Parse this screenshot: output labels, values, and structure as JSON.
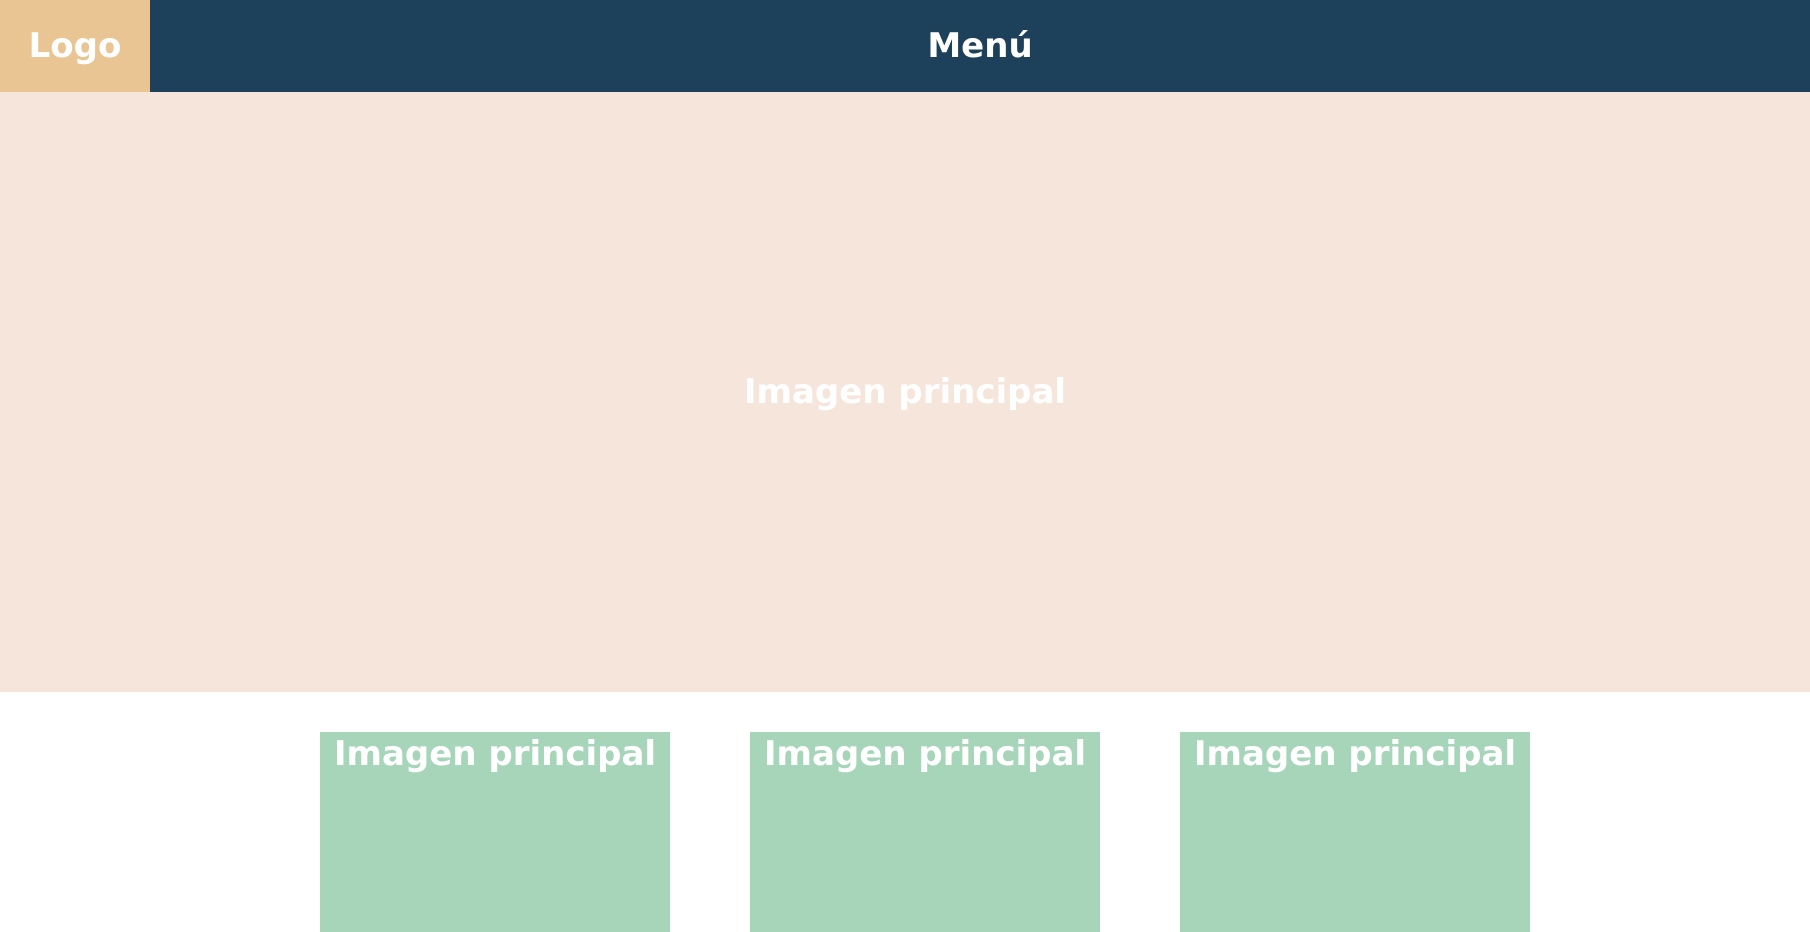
{
  "header": {
    "logo_label": "Logo",
    "menu_label": "Menú"
  },
  "hero": {
    "label": "Imagen principal"
  },
  "cards": [
    {
      "label": "Imagen principal"
    },
    {
      "label": "Imagen principal"
    },
    {
      "label": "Imagen principal"
    }
  ],
  "colors": {
    "logo_bg": "#e9c593",
    "menu_bg": "#1d405b",
    "hero_bg": "#f5e5db",
    "card_bg": "#a6d5b9",
    "text": "#ffffff"
  }
}
